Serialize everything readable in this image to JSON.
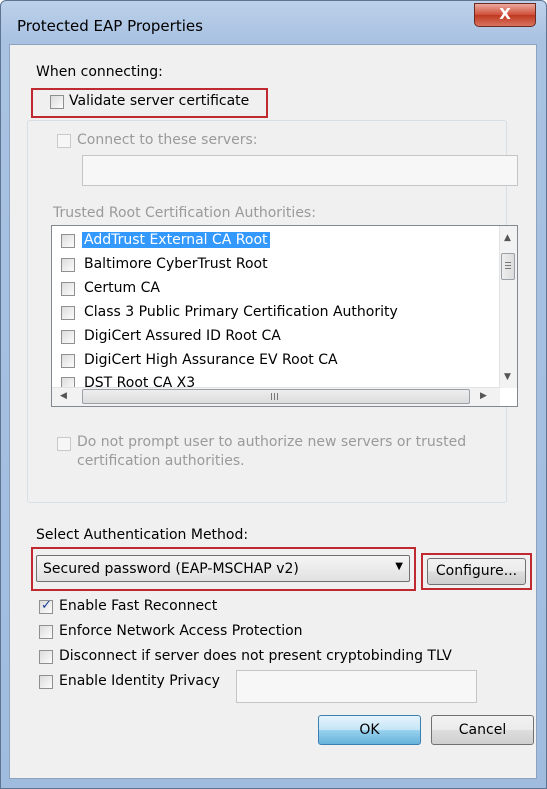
{
  "window": {
    "title": "Protected EAP Properties",
    "close_label": "X"
  },
  "connecting": {
    "heading": "When connecting:",
    "validate_label": "Validate server certificate",
    "connect_label": "Connect to these servers:",
    "servers_value": "",
    "trusted_label": "Trusted Root Certification Authorities:",
    "authorities": [
      {
        "name": "AddTrust External CA Root",
        "checked": false,
        "selected": true
      },
      {
        "name": "Baltimore CyberTrust Root",
        "checked": false,
        "selected": false
      },
      {
        "name": "Certum CA",
        "checked": false,
        "selected": false
      },
      {
        "name": "Class 3 Public Primary Certification Authority",
        "checked": false,
        "selected": false
      },
      {
        "name": "DigiCert Assured ID Root CA",
        "checked": false,
        "selected": false
      },
      {
        "name": "DigiCert High Assurance EV Root CA",
        "checked": false,
        "selected": false
      },
      {
        "name": "DST Root CA X3",
        "checked": false,
        "selected": false
      }
    ],
    "no_prompt_line1": "Do not prompt user to authorize new servers or trusted",
    "no_prompt_line2": "certification authorities."
  },
  "auth": {
    "heading": "Select Authentication Method:",
    "method_value": "Secured password (EAP-MSCHAP v2)",
    "configure_label": "Configure...",
    "options": [
      {
        "label": "Enable Fast Reconnect",
        "checked": true
      },
      {
        "label": "Enforce Network Access Protection",
        "checked": false
      },
      {
        "label": "Disconnect if server does not present cryptobinding TLV",
        "checked": false
      },
      {
        "label": "Enable Identity Privacy",
        "checked": false
      }
    ],
    "identity_value": ""
  },
  "buttons": {
    "ok": "OK",
    "cancel": "Cancel"
  },
  "icons": {
    "close": "close-icon",
    "dropdown": "chevron-down-icon",
    "scroll_up": "arrow-up-icon",
    "scroll_down": "arrow-down-icon",
    "scroll_left": "arrow-left-icon",
    "scroll_right": "arrow-right-icon"
  },
  "colors": {
    "highlight": "#c0292f",
    "selection": "#3399ff",
    "check": "#1a3f9c"
  }
}
